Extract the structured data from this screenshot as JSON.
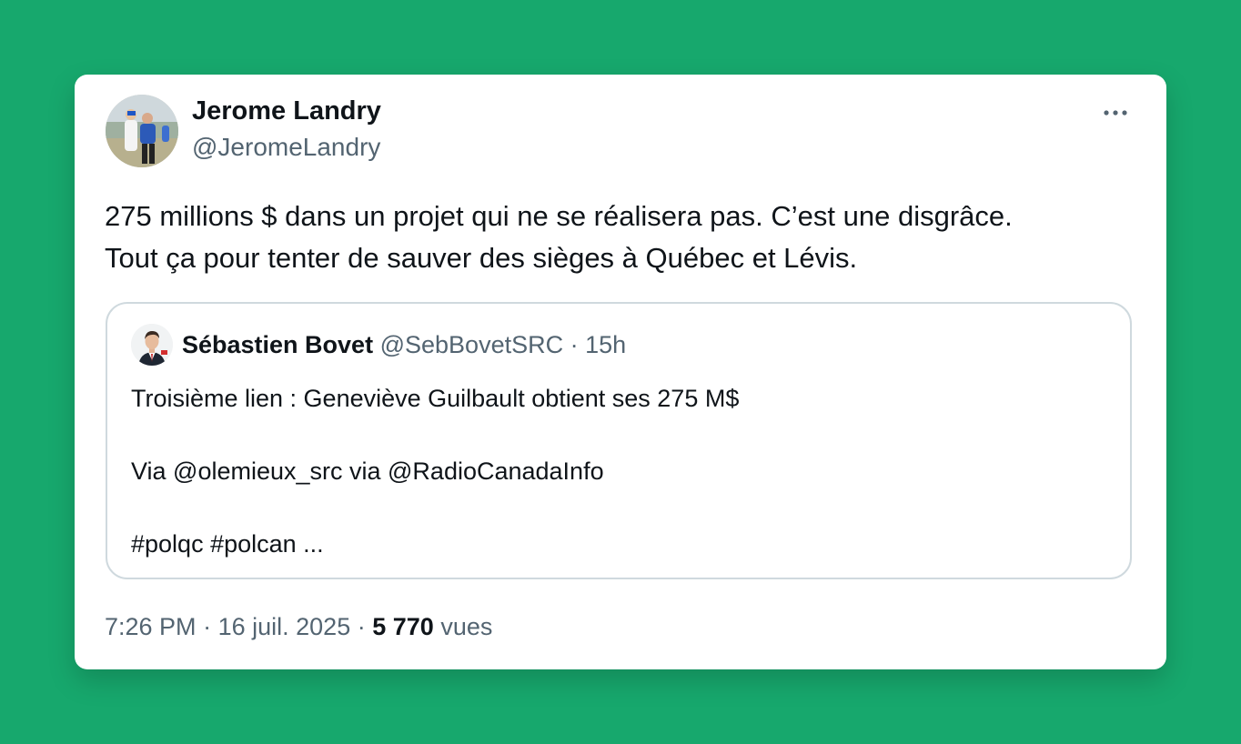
{
  "author": {
    "name": "Jerome Landry",
    "handle": "@JeromeLandry",
    "avatar_icon": "profile-photo"
  },
  "menu": {
    "icon": "more-horizontal-icon"
  },
  "tweet": {
    "lines": [
      "275 millions $ dans un projet qui ne se réalisera pas. C’est une disgrâce.",
      "Tout ça pour tenter de sauver des sièges à Québec et Lévis."
    ]
  },
  "quote": {
    "name": "Sébastien Bovet",
    "handle": "@SebBovetSRC",
    "separator": "·",
    "time": "15h",
    "lines": [
      "Troisième lien : Geneviève Guilbault obtient ses 275 M$",
      "Via @olemieux_src via @RadioCanadaInfo",
      "#polqc #polcan ..."
    ]
  },
  "meta": {
    "time": "7:26 PM",
    "separator": "·",
    "date": "16 juil. 2025",
    "views_count": "5 770",
    "views_label": "vues"
  },
  "colors": {
    "background": "#17a86d",
    "card": "#ffffff",
    "text_primary": "#0f1419",
    "text_secondary": "#536471",
    "border": "#cfd9de"
  }
}
